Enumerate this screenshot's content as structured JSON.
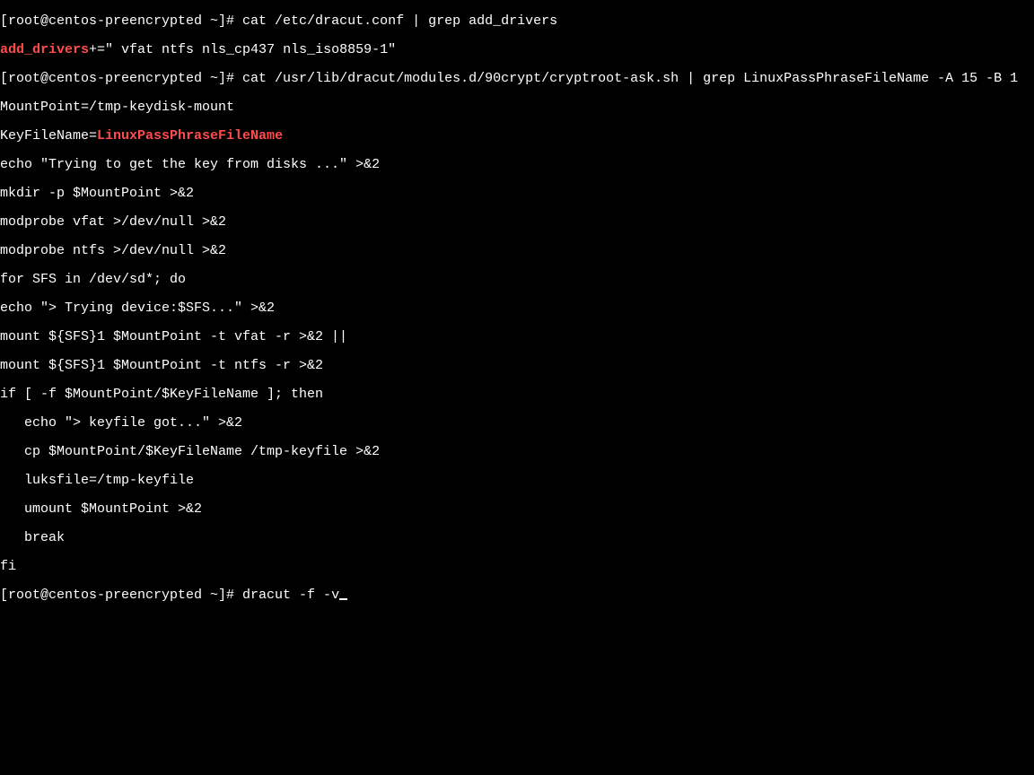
{
  "colors": {
    "bg": "#000000",
    "fg": "#ffffff",
    "highlight": "#ff4d4d"
  },
  "prompts": {
    "p1": "[root@centos-preencrypted ~]# ",
    "p2": "[root@centos-preencrypted ~]# ",
    "p3": "[root@centos-preencrypted ~]# "
  },
  "commands": {
    "cmd1": "cat /etc/dracut.conf | grep add_drivers",
    "cmd2": "cat /usr/lib/dracut/modules.d/90crypt/cryptroot-ask.sh | grep LinuxPassPhraseFileName -A 15 -B 1",
    "cmd3": "dracut -f -v"
  },
  "out1": {
    "hl": "add_drivers",
    "rest": "+=\" vfat ntfs nls_cp437 nls_iso8859-1\""
  },
  "out2": {
    "l1a": "MountPoint=/tmp-keydisk-mount",
    "l2a": "KeyFileName=",
    "l2hl": "LinuxPassPhraseFileName",
    "l3": "echo \"Trying to get the key from disks ...\" >&2",
    "l4": "mkdir -p $MountPoint >&2",
    "l5": "modprobe vfat >/dev/null >&2",
    "l6": "modprobe ntfs >/dev/null >&2",
    "l7": "for SFS in /dev/sd*; do",
    "l8": "echo \"> Trying device:$SFS...\" >&2",
    "l9": "mount ${SFS}1 $MountPoint -t vfat -r >&2 ||",
    "l10": "mount ${SFS}1 $MountPoint -t ntfs -r >&2",
    "l11": "if [ -f $MountPoint/$KeyFileName ]; then",
    "l12": "   echo \"> keyfile got...\" >&2",
    "l13": "   cp $MountPoint/$KeyFileName /tmp-keyfile >&2",
    "l14": "   luksfile=/tmp-keyfile",
    "l15": "   umount $MountPoint >&2",
    "l16": "   break",
    "l17": "fi"
  }
}
